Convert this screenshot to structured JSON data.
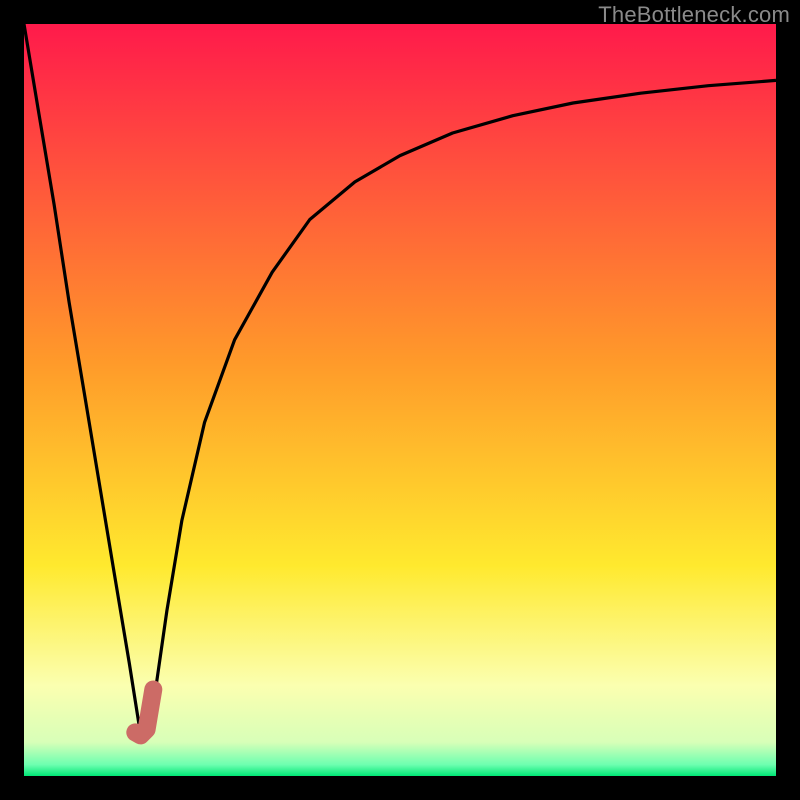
{
  "watermark": {
    "text": "TheBottleneck.com"
  },
  "colors": {
    "top": "#ff1a4b",
    "orange": "#ff8a2a",
    "yellow": "#ffe92e",
    "pale": "#fbffa8",
    "green": "#00e676",
    "curve": "#000000",
    "highlight": "#cc6b66",
    "frame": "#000000"
  },
  "chart_data": {
    "type": "line",
    "title": "",
    "xlabel": "",
    "ylabel": "",
    "xlim": [
      0,
      100
    ],
    "ylim": [
      0,
      100
    ],
    "grid": false,
    "series": [
      {
        "name": "bottleneck-curve",
        "x": [
          0,
          2,
          4,
          6,
          8,
          10,
          12,
          14,
          15.5,
          17,
          19,
          21,
          24,
          28,
          33,
          38,
          44,
          50,
          57,
          65,
          73,
          82,
          91,
          100
        ],
        "values": [
          100,
          88,
          76,
          63,
          51,
          39,
          27,
          15,
          5.5,
          8,
          22,
          34,
          47,
          58,
          67,
          74,
          79,
          82.5,
          85.5,
          87.8,
          89.5,
          90.8,
          91.8,
          92.5
        ]
      },
      {
        "name": "highlight-segment",
        "x": [
          14.8,
          15.5,
          16.3,
          17.2
        ],
        "values": [
          5.8,
          5.4,
          6.2,
          11.5
        ]
      }
    ],
    "gradient_stops": [
      {
        "pos": 0.0,
        "color": "#ff1a4b"
      },
      {
        "pos": 0.45,
        "color": "#ff9a2a"
      },
      {
        "pos": 0.72,
        "color": "#ffe92e"
      },
      {
        "pos": 0.88,
        "color": "#fbffb0"
      },
      {
        "pos": 0.955,
        "color": "#d8ffb8"
      },
      {
        "pos": 0.985,
        "color": "#6dffb0"
      },
      {
        "pos": 1.0,
        "color": "#00e676"
      }
    ]
  }
}
